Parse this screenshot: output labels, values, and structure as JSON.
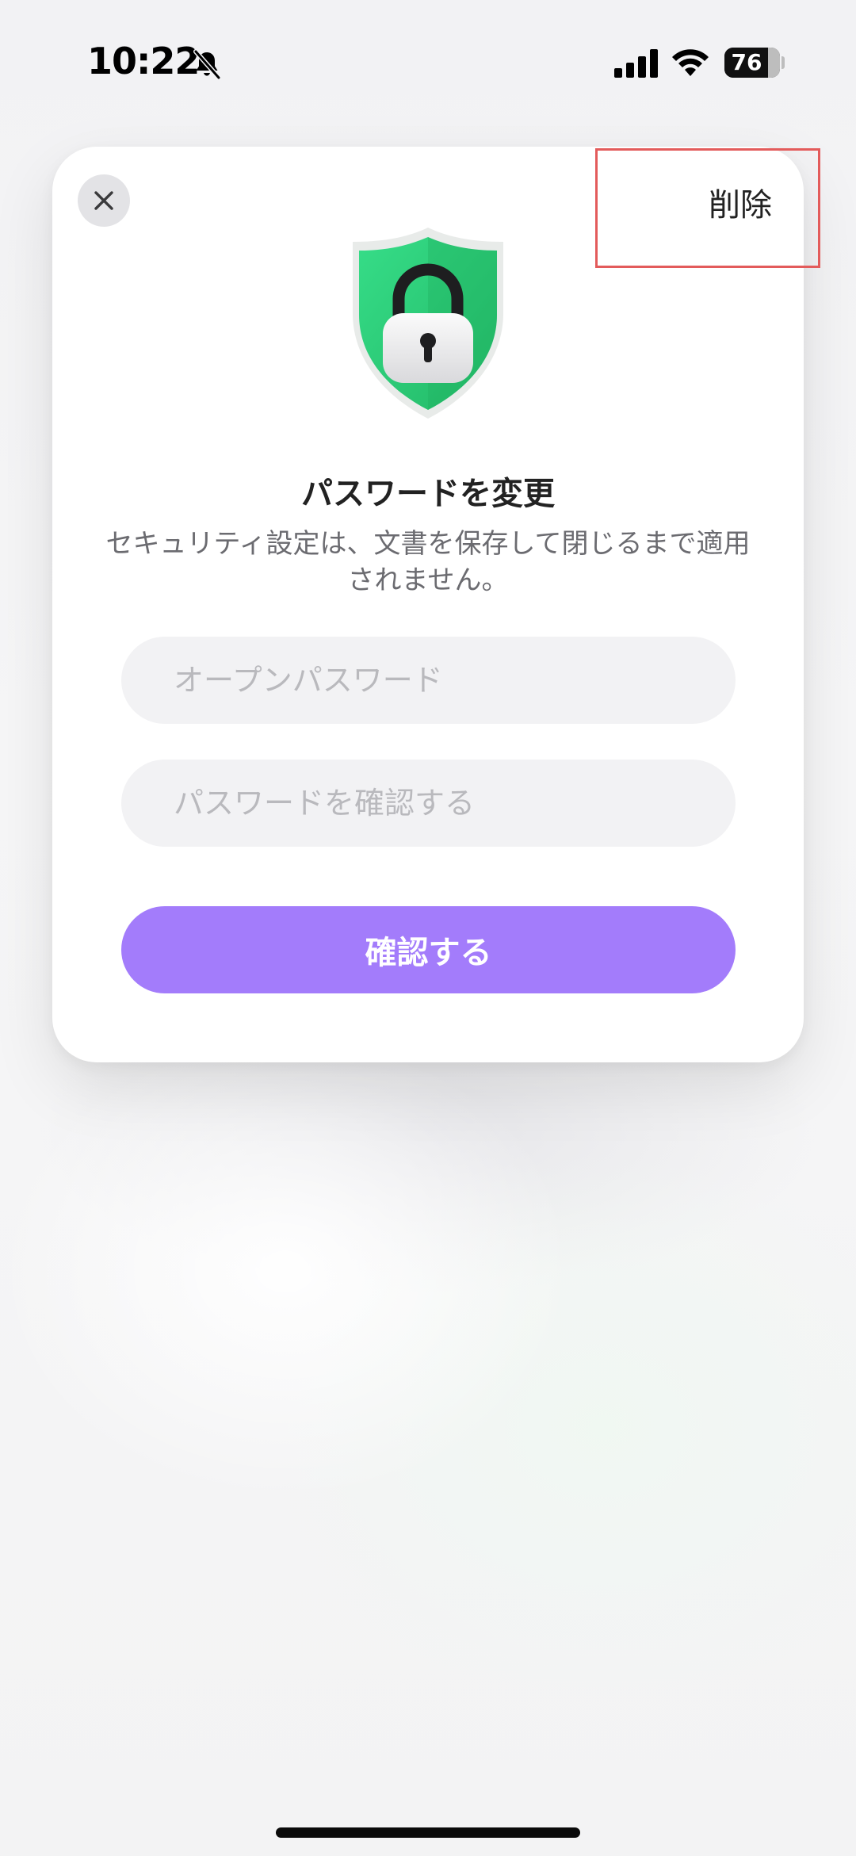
{
  "status_bar": {
    "time": "10:22",
    "battery_level": "76",
    "battery_fraction": 0.76,
    "icons": [
      "bell-slash-icon",
      "cellular-signal-icon",
      "wifi-icon",
      "battery-icon"
    ]
  },
  "dialog": {
    "close_icon": "close-icon",
    "delete_label": "削除",
    "shield_icon": "shield-lock-icon",
    "title": "パスワードを変更",
    "subtitle": "セキュリティ設定は、文書を保存して閉じるまで適用されません。",
    "open_password": {
      "placeholder": "オープンパスワード",
      "value": ""
    },
    "confirm_password": {
      "placeholder": "パスワードを確認する",
      "value": ""
    },
    "confirm_button_label": "確認する"
  },
  "colors": {
    "accent_button": "#a37cfb",
    "shield_green": "#2fce7a",
    "delete_highlight_border": "#e35b5b",
    "input_background": "#f2f2f4"
  }
}
